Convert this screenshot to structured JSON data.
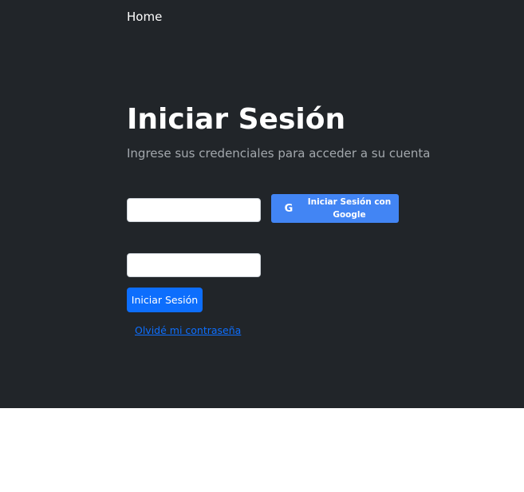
{
  "nav": {
    "home_label": "Home"
  },
  "login": {
    "title": "Iniciar Sesión",
    "subtitle": "Ingrese sus credenciales para acceder a su cuenta",
    "username_value": "",
    "password_value": "",
    "google_button_icon": "google-icon",
    "google_button_icon_glyph": "G",
    "google_button_label": "Iniciar Sesión con Google",
    "submit_label": "Iniciar Sesión",
    "forgot_password_label": "Olvidé mi contraseña"
  },
  "colors": {
    "dark_background": "#212529",
    "primary": "#0d6efd",
    "google_blue": "#4285f4"
  }
}
